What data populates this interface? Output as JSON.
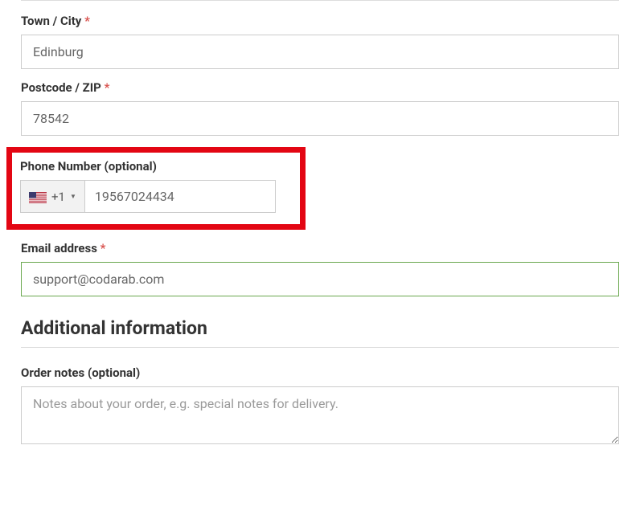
{
  "fields": {
    "town": {
      "label": "Town / City",
      "required": "*",
      "value": "Edinburg"
    },
    "postcode": {
      "label": "Postcode / ZIP",
      "required": "*",
      "value": "78542"
    },
    "phone": {
      "label": "Phone Number (optional)",
      "dialcode": "+1",
      "value": "19567024434",
      "flag_icon": "us-flag"
    },
    "email": {
      "label": "Email address",
      "required": "*",
      "value": "support@codarab.com"
    },
    "order_notes": {
      "label": "Order notes (optional)",
      "placeholder": "Notes about your order, e.g. special notes for delivery."
    }
  },
  "section": {
    "additional_info": "Additional information"
  }
}
